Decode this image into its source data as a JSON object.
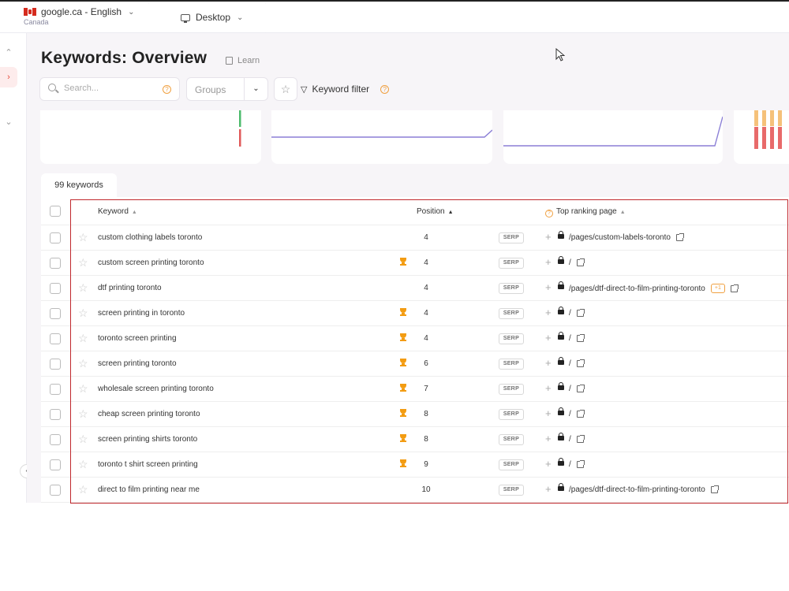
{
  "topbar": {
    "database_label": "google.ca - English",
    "database_country": "Canada",
    "device_label": "Desktop"
  },
  "page": {
    "title": "Keywords: Overview",
    "learn_label": "Learn"
  },
  "toolbar": {
    "search_placeholder": "Search...",
    "groups_label": "Groups",
    "keyword_filter_label": "Keyword filter"
  },
  "colors": {
    "accent_red": "#c0282d",
    "trophy": "#f39c12",
    "chart_line": "#8b7fd6"
  },
  "tabs": [
    {
      "label": "99 keywords"
    }
  ],
  "table": {
    "headers": {
      "keyword": "Keyword",
      "position": "Position",
      "top_ranking_page": "Top ranking page"
    },
    "serp_label": "SERP",
    "rows": [
      {
        "keyword": "custom clothing labels toronto",
        "trophy": false,
        "position": "4",
        "url": "/pages/custom-labels-toronto",
        "badge": ""
      },
      {
        "keyword": "custom screen printing toronto",
        "trophy": true,
        "position": "4",
        "url": "/",
        "badge": ""
      },
      {
        "keyword": "dtf printing toronto",
        "trophy": false,
        "position": "4",
        "url": "/pages/dtf-direct-to-film-printing-toronto",
        "badge": "+1"
      },
      {
        "keyword": "screen printing in toronto",
        "trophy": true,
        "position": "4",
        "url": "/",
        "badge": ""
      },
      {
        "keyword": "toronto screen printing",
        "trophy": true,
        "position": "4",
        "url": "/",
        "badge": ""
      },
      {
        "keyword": "screen printing toronto",
        "trophy": true,
        "position": "6",
        "url": "/",
        "badge": ""
      },
      {
        "keyword": "wholesale screen printing toronto",
        "trophy": true,
        "position": "7",
        "url": "/",
        "badge": ""
      },
      {
        "keyword": "cheap screen printing toronto",
        "trophy": true,
        "position": "8",
        "url": "/",
        "badge": ""
      },
      {
        "keyword": "screen printing shirts toronto",
        "trophy": true,
        "position": "8",
        "url": "/",
        "badge": ""
      },
      {
        "keyword": "toronto t shirt screen printing",
        "trophy": true,
        "position": "9",
        "url": "/",
        "badge": ""
      },
      {
        "keyword": "direct to film printing near me",
        "trophy": false,
        "position": "10",
        "url": "/pages/dtf-direct-to-film-printing-toronto",
        "badge": ""
      }
    ]
  }
}
